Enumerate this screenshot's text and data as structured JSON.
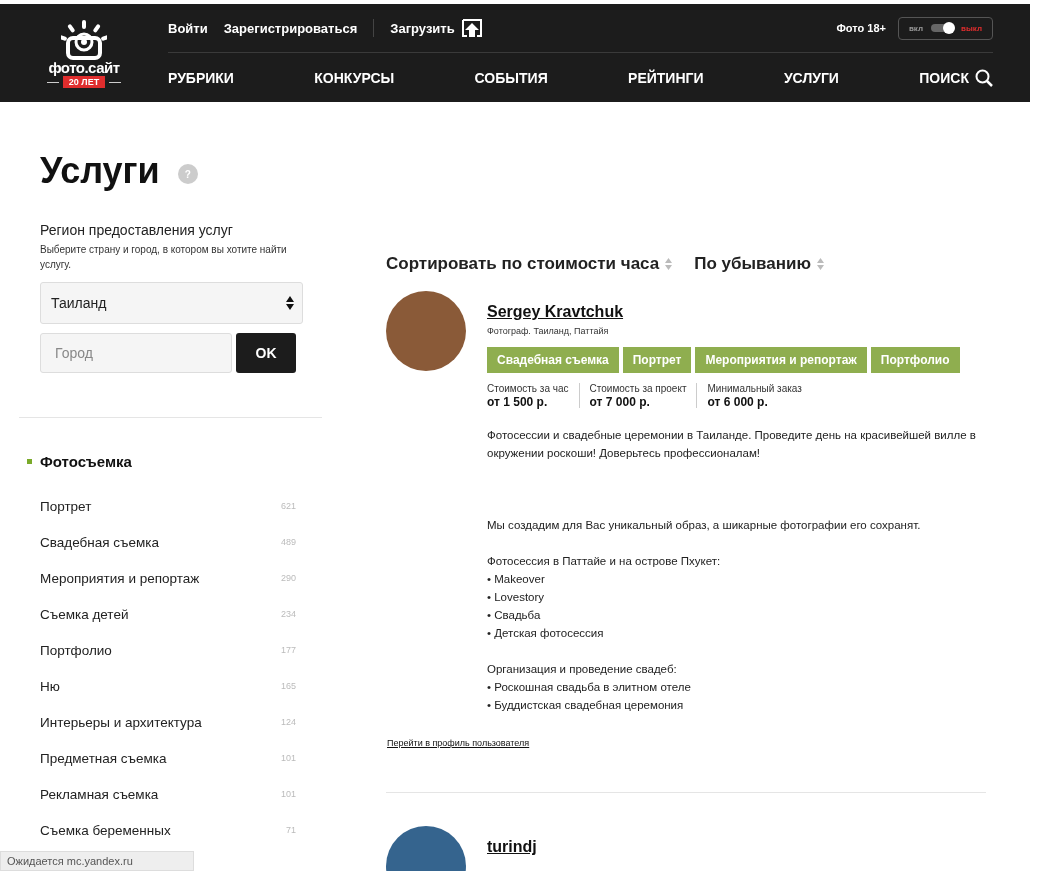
{
  "header": {
    "logo": {
      "name": "фото.сайт",
      "badge": "20 ЛЕТ"
    },
    "top_links": [
      {
        "label": "Войти"
      },
      {
        "label": "Зарегистрироваться"
      }
    ],
    "upload": {
      "label": "Загрузить"
    },
    "adult_filter": {
      "label": "Фото 18+",
      "on_label": "вкл",
      "off_label": "выкл",
      "on": false
    },
    "nav": [
      {
        "label": "РУБРИКИ"
      },
      {
        "label": "КОНКУРСЫ"
      },
      {
        "label": "СОБЫТИЯ"
      },
      {
        "label": "РЕЙТИНГИ"
      },
      {
        "label": "УСЛУГИ"
      }
    ],
    "search": {
      "label": "ПОИСК"
    }
  },
  "sidebar": {
    "title": "Услуги",
    "help": "?",
    "region_label": "Регион предоставления услуг",
    "region_hint": "Выберите страну и город, в котором вы хотите найти услугу.",
    "country": "Таиланд",
    "city_placeholder": "Город",
    "ok_button": "OK",
    "category": "Фотосъемка",
    "items": [
      {
        "label": "Портрет",
        "count": "621"
      },
      {
        "label": "Свадебная съемка",
        "count": "489"
      },
      {
        "label": "Мероприятия и репортаж",
        "count": "290"
      },
      {
        "label": "Съемка детей",
        "count": "234"
      },
      {
        "label": "Портфолио",
        "count": "177"
      },
      {
        "label": "Ню",
        "count": "165"
      },
      {
        "label": "Интерьеры и архитектура",
        "count": "124"
      },
      {
        "label": "Предметная съемка",
        "count": "101"
      },
      {
        "label": "Рекламная съемка",
        "count": "101"
      },
      {
        "label": "Съемка беременных",
        "count": "71"
      }
    ]
  },
  "sort": [
    {
      "label": "Сортировать по стоимости часа"
    },
    {
      "label": "По убыванию"
    }
  ],
  "listings": [
    {
      "name": "Sergey Kravtchuk",
      "subtitle": "Фотограф. Таиланд, Паттайя",
      "tags": [
        "Свадебная съемка",
        "Портрет",
        "Мероприятия и репортаж",
        "Портфолио"
      ],
      "prices": [
        {
          "label": "Стоимость за час",
          "value": "от 1 500 р."
        },
        {
          "label": "Стоимость за проект",
          "value": "от 7 000 р."
        },
        {
          "label": "Минимальный заказ",
          "value": "от 6 000 р."
        }
      ],
      "description": [
        [
          "Фотосессии и свадебные церемонии в Таиланде. Проведите день на красивейшей вилле в окружении роскоши! Доверьтесь профессионалам!"
        ],
        [
          "Мы создадим для Вас уникальный образ, а шикарные фотографии его сохранят."
        ],
        [
          "Фотосессия в Паттайе и на острове Пхукет:",
          "• Makeover",
          "• Lovestory",
          "• Свадьба",
          "• Детская фотосессия"
        ],
        [
          "Организация и проведение свадеб:",
          "• Роскошная свадьба в элитном отеле",
          "• Буддистская свадебная церемония"
        ]
      ],
      "profile_link": "Перейти в профиль пользователя"
    },
    {
      "name": "turindj"
    }
  ],
  "status_bar": "Ожидается mc.yandex.ru"
}
